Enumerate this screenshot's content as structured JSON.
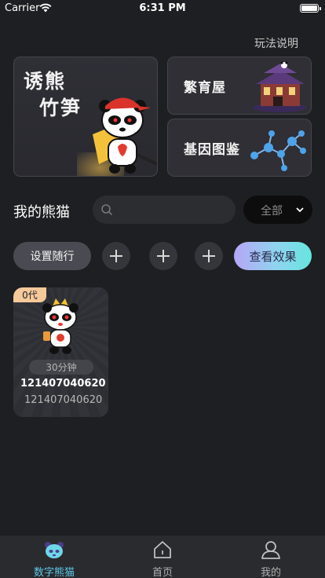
{
  "status_bar": {
    "carrier": "Carrier",
    "time": "6:31 PM"
  },
  "header": {
    "rules_link": "玩法说明"
  },
  "features": {
    "lure": {
      "line1": "诱熊",
      "line2": "竹笋"
    },
    "breeding": {
      "title": "繁育屋"
    },
    "gene": {
      "title": "基因图鉴"
    }
  },
  "my_pandas": {
    "title": "我的熊猫",
    "search": {
      "placeholder": "",
      "value": ""
    },
    "filter": {
      "selected": "全部"
    }
  },
  "actions": {
    "follow_label": "设置随行",
    "effect_label": "查看效果"
  },
  "pandas": [
    {
      "generation": "0代",
      "timer": "30分钟",
      "name": "121407040620",
      "id": "121407040620"
    }
  ],
  "tabs": [
    {
      "label": "数字熊猫",
      "icon": "panda-icon",
      "active": true
    },
    {
      "label": "首页",
      "icon": "home-icon",
      "active": false
    },
    {
      "label": "我的",
      "icon": "profile-icon",
      "active": false
    }
  ],
  "colors": {
    "accent": "#5bc8e6",
    "background": "#1e1f22",
    "badge": "#f5c99a"
  }
}
